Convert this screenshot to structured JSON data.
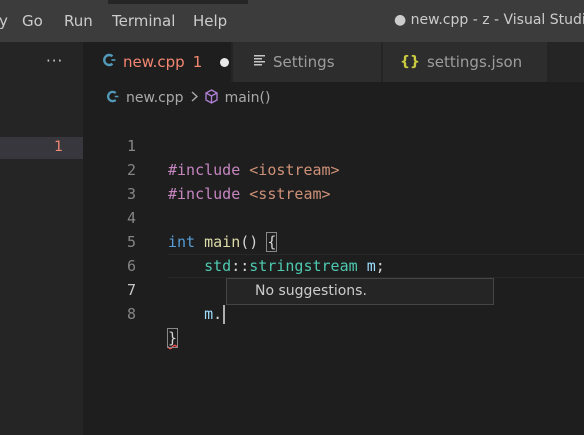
{
  "menu": {
    "items": [
      "y",
      "Go",
      "Run",
      "Terminal",
      "Help"
    ]
  },
  "window_title": "● new.cpp - z - Visual Studio",
  "sidebar": {
    "more_icon": "···",
    "problem_count": "1"
  },
  "tabs": [
    {
      "label": "new.cpp",
      "problems": "1",
      "icon": "C++ file icon",
      "state": "active, unsaved"
    },
    {
      "label": "Settings",
      "icon": "settings-lines-icon"
    },
    {
      "label": "settings.json",
      "icon": "json-braces-icon"
    }
  ],
  "breadcrumb": {
    "file": "new.cpp",
    "symbol": "main()"
  },
  "editor": {
    "lines": [
      {
        "n": "1",
        "text": "#include <iostream>"
      },
      {
        "n": "2",
        "text": "#include <sstream>"
      },
      {
        "n": "3",
        "text": ""
      },
      {
        "n": "4",
        "text": "int main() {"
      },
      {
        "n": "5",
        "text": "    std::stringstream m;"
      },
      {
        "n": "6",
        "text": ""
      },
      {
        "n": "7",
        "text": "    m."
      },
      {
        "n": "8",
        "text": "}"
      }
    ],
    "current_line": "7"
  },
  "suggest": {
    "text": "No suggestions."
  },
  "colors": {
    "accent_error": "#f48771",
    "background": "#1e1e1e",
    "sidebar": "#252526",
    "titlebar": "#3c3c3c"
  }
}
